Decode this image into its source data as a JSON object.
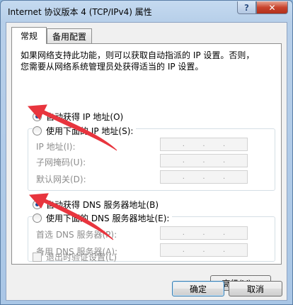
{
  "window": {
    "title": "Internet 协议版本 4 (TCP/IPv4) 属性",
    "help_label": "?",
    "close_label": "✕"
  },
  "tabs": [
    {
      "label": "常规",
      "active": true
    },
    {
      "label": "备用配置",
      "active": false
    }
  ],
  "intro": {
    "line1": "如果网络支持此功能，则可以获取自动指派的 IP 设置。否则，",
    "line2": "您需要从网络系统管理员处获得适当的 IP 设置。"
  },
  "ip_section": {
    "auto_label": "自动获得 IP 地址(O)",
    "auto_checked": true,
    "manual_label": "使用下面的 IP 地址(S):",
    "manual_checked": false,
    "fields": [
      {
        "label": "IP 地址(I):",
        "value": ". . ."
      },
      {
        "label": "子网掩码(U):",
        "value": ". . ."
      },
      {
        "label": "默认网关(D):",
        "value": ". . ."
      }
    ]
  },
  "dns_section": {
    "auto_label": "自动获得 DNS 服务器地址(B)",
    "auto_checked": true,
    "manual_label": "使用下面的 DNS 服务器地址(E):",
    "manual_checked": false,
    "fields": [
      {
        "label": "首选 DNS 服务器(P):",
        "value": ". . ."
      },
      {
        "label": "备用 DNS 服务器(A):",
        "value": ". . ."
      }
    ]
  },
  "validate_on_exit_label": "退出时验证设置(L)",
  "validate_on_exit_checked": false,
  "buttons": {
    "advanced": "高级(V)...",
    "ok": "确定",
    "cancel": "取消"
  },
  "colors": {
    "annotation_arrow": "#e8353e"
  }
}
